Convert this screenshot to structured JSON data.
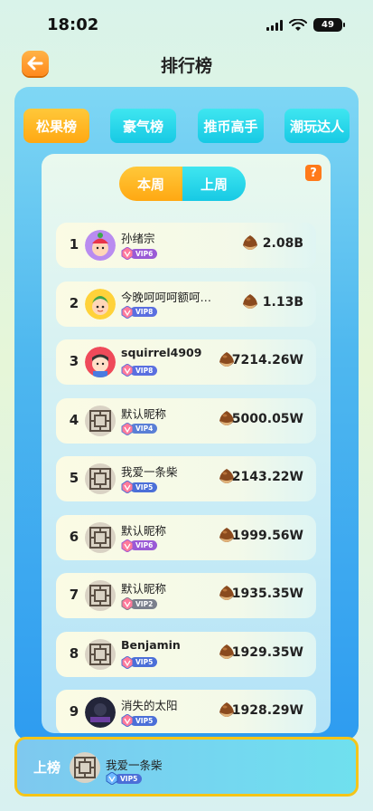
{
  "status": {
    "time": "18:02",
    "battery": "49"
  },
  "header": {
    "title": "排行榜"
  },
  "tabs": [
    {
      "label": "松果榜",
      "active": true
    },
    {
      "label": "豪气榜",
      "active": false
    },
    {
      "label": "推币高手",
      "active": false
    },
    {
      "label": "潮玩达人",
      "active": false
    }
  ],
  "period_toggle": {
    "options": [
      "本周",
      "上周"
    ],
    "selected": "本周"
  },
  "help": {
    "label": "?"
  },
  "ranking": [
    {
      "rank": "1",
      "name": "孙绪宗",
      "vip": "VIP6",
      "score": "2.08B",
      "avatar": "cartoon-boy-red-hat"
    },
    {
      "rank": "2",
      "name": "今晚呵呵呵额呵…",
      "vip": "VIP8",
      "score": "1.13B",
      "avatar": "cartoon-kid-green-hair"
    },
    {
      "rank": "3",
      "name": "squirrel4909",
      "vip": "VIP8",
      "score": "7214.26W",
      "avatar": "cartoon-boy-red-bg"
    },
    {
      "rank": "4",
      "name": "默认昵称",
      "vip": "VIP4",
      "score": "5000.05W",
      "avatar": "default-pattern"
    },
    {
      "rank": "5",
      "name": "我爱一条柴",
      "vip": "VIP5",
      "score": "2143.22W",
      "avatar": "default-pattern"
    },
    {
      "rank": "6",
      "name": "默认昵称",
      "vip": "VIP6",
      "score": "1999.56W",
      "avatar": "default-pattern"
    },
    {
      "rank": "7",
      "name": "默认昵称",
      "vip": "VIP2",
      "score": "1935.35W",
      "avatar": "default-pattern"
    },
    {
      "rank": "8",
      "name": "Benjamin",
      "vip": "VIP5",
      "score": "1929.35W",
      "avatar": "default-pattern"
    },
    {
      "rank": "9",
      "name": "消失的太阳",
      "vip": "VIP5",
      "score": "1928.29W",
      "avatar": "dark-photo"
    }
  ],
  "my_rank": {
    "label": "上榜",
    "name": "我爱一条柴",
    "vip": "VIP5"
  },
  "colors": {
    "accent_orange": "#ffa812",
    "accent_cyan": "#17c9e4",
    "panel_blue": "#2e9cf0",
    "highlight_border": "#f5c518"
  },
  "vip_colors": {
    "VIP2": "#7a7f8c",
    "VIP4": "#5a7fd6",
    "VIP5": "#4b6fd8",
    "VIP6": "#9a5ad6",
    "VIP8": "#5a6fe0"
  },
  "icons": {
    "back": "arrow-left-icon",
    "help": "question-icon",
    "currency": "chestnut-icon",
    "vip": "vip-gem-icon"
  }
}
